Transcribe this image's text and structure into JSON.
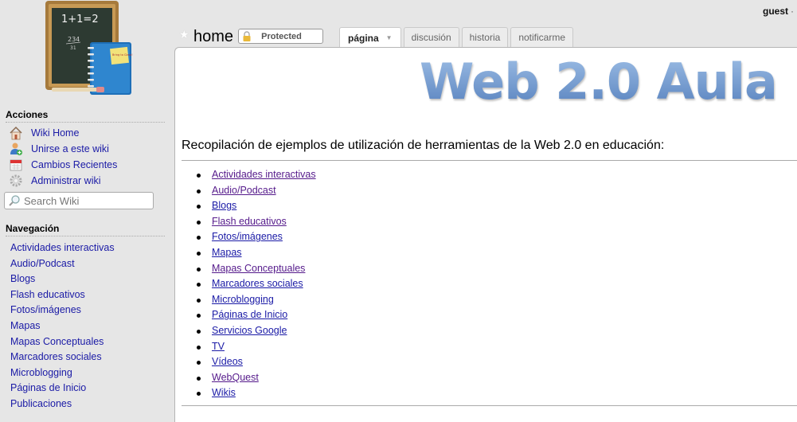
{
  "user": {
    "name": "guest",
    "separator": "·"
  },
  "sidebar": {
    "logo_alt": "Chalkboard with 1+1=2 and notebook",
    "logo_text": {
      "board_line1": "1+1=2",
      "board_line2": "234",
      "board_line3": "31",
      "note": "Bring to Class!"
    },
    "actions_title": "Acciones",
    "actions": [
      {
        "label": "Wiki Home",
        "icon": "house-icon"
      },
      {
        "label": "Unirse a este wiki",
        "icon": "user-add-icon"
      },
      {
        "label": "Cambios Recientes",
        "icon": "calendar-icon"
      },
      {
        "label": "Administrar wiki",
        "icon": "gear-icon"
      }
    ],
    "search": {
      "placeholder": "Search Wiki",
      "value": ""
    },
    "nav_title": "Navegación",
    "nav": [
      "Actividades interactivas",
      "Audio/Podcast",
      "Blogs",
      "Flash educativos",
      "Fotos/imágenes",
      "Mapas",
      "Mapas Conceptuales",
      "Marcadores sociales",
      "Microblogging",
      "Páginas de Inicio",
      "Publicaciones"
    ]
  },
  "page": {
    "name": "home",
    "protected_label": "Protected",
    "tabs": [
      {
        "label": "página",
        "active": true,
        "has_dropdown": true
      },
      {
        "label": "discusión",
        "active": false
      },
      {
        "label": "historia",
        "active": false
      },
      {
        "label": "notificarme",
        "active": false
      }
    ]
  },
  "content": {
    "banner": "Web 2.0 Aula",
    "heading": "Recopilación de ejemplos de utilización de herramientas de la Web 2.0 en educación:",
    "links": [
      {
        "label": "Actividades interactivas",
        "visited": true
      },
      {
        "label": "Audio/Podcast",
        "visited": true
      },
      {
        "label": "Blogs",
        "visited": false
      },
      {
        "label": "Flash educativos",
        "visited": true
      },
      {
        "label": "Fotos/imágenes",
        "visited": false
      },
      {
        "label": "Mapas",
        "visited": false
      },
      {
        "label": "Mapas Conceptuales",
        "visited": true
      },
      {
        "label": "Marcadores sociales",
        "visited": false
      },
      {
        "label": "Microblogging",
        "visited": false
      },
      {
        "label": "Páginas de Inicio",
        "visited": false
      },
      {
        "label": "Servicios Google",
        "visited": false
      },
      {
        "label": "TV",
        "visited": false
      },
      {
        "label": "Vídeos",
        "visited": false
      },
      {
        "label": "WebQuest",
        "visited": true
      },
      {
        "label": "Wikis",
        "visited": false
      }
    ]
  }
}
